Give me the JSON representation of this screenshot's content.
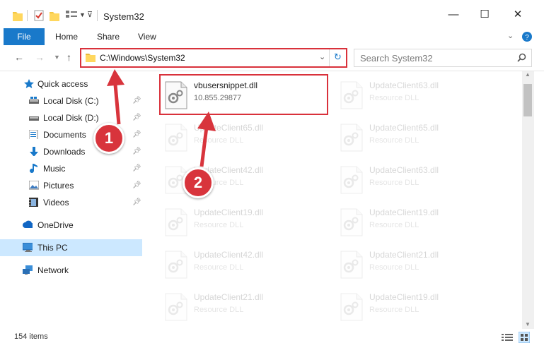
{
  "window": {
    "title": "System32"
  },
  "window_controls": {
    "minimize": "—",
    "maximize": "☐",
    "close": "✕"
  },
  "ribbon": {
    "tabs": [
      "File",
      "Home",
      "Share",
      "View"
    ]
  },
  "nav": {
    "address": "C:\\Windows\\System32",
    "search_placeholder": "Search System32"
  },
  "sidebar": {
    "items": [
      {
        "label": "Quick access",
        "icon": "star-icon",
        "pinned": false
      },
      {
        "label": "Local Disk (C:)",
        "icon": "drive-icon",
        "pinned": true
      },
      {
        "label": "Local Disk (D:)",
        "icon": "drive-icon",
        "pinned": true
      },
      {
        "label": "Documents",
        "icon": "documents-icon",
        "pinned": true
      },
      {
        "label": "Downloads",
        "icon": "downloads-icon",
        "pinned": true
      },
      {
        "label": "Music",
        "icon": "music-icon",
        "pinned": true
      },
      {
        "label": "Pictures",
        "icon": "pictures-icon",
        "pinned": true
      },
      {
        "label": "Videos",
        "icon": "videos-icon",
        "pinned": true
      },
      {
        "label": "OneDrive",
        "icon": "cloud-icon",
        "pinned": false
      },
      {
        "label": "This PC",
        "icon": "pc-icon",
        "pinned": false
      },
      {
        "label": "Network",
        "icon": "network-icon",
        "pinned": false
      }
    ]
  },
  "files": [
    {
      "name": "vbusersnippet.dll",
      "desc": "10.855.29877"
    },
    {
      "name": "UpdateClient63.dll",
      "desc": "Resource DLL"
    },
    {
      "name": "UpdateClient65.dll",
      "desc": "Resource DLL"
    },
    {
      "name": "UpdateClient65.dll",
      "desc": "Resource DLL"
    },
    {
      "name": "UpdateClient42.dll",
      "desc": "Resource DLL"
    },
    {
      "name": "UpdateClient63.dll",
      "desc": "Resource DLL"
    },
    {
      "name": "UpdateClient19.dll",
      "desc": "Resource DLL"
    },
    {
      "name": "UpdateClient19.dll",
      "desc": "Resource DLL"
    },
    {
      "name": "UpdateClient42.dll",
      "desc": "Resource DLL"
    },
    {
      "name": "UpdateClient21.dll",
      "desc": "Resource DLL"
    },
    {
      "name": "UpdateClient21.dll",
      "desc": "Resource DLL"
    },
    {
      "name": "UpdateClient19.dll",
      "desc": "Resource DLL"
    }
  ],
  "annotations": {
    "step1": "1",
    "step2": "2"
  },
  "status": {
    "count": "154 items"
  },
  "colors": {
    "accent": "#1979ca",
    "highlight": "#d9313b",
    "selected": "#cce8ff"
  }
}
